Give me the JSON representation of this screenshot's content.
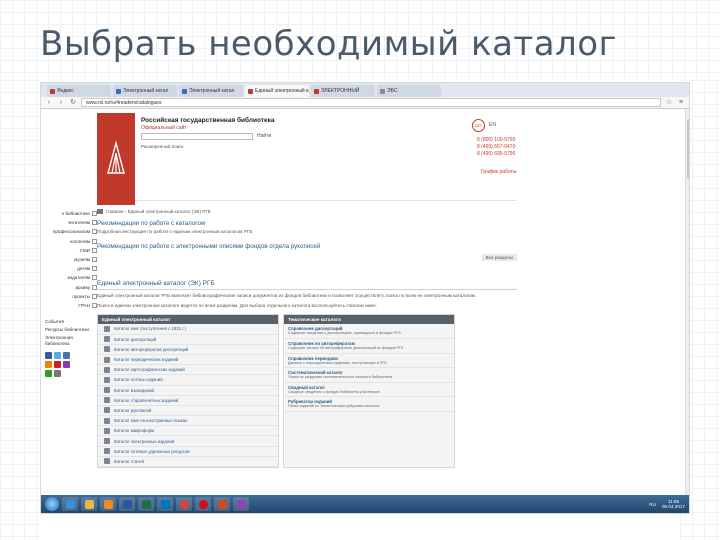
{
  "slide": {
    "title": "Выбрать необходимый каталог"
  },
  "browser": {
    "tabs": [
      {
        "label": "Яндекс",
        "fav": "red"
      },
      {
        "label": "Электронный катал",
        "fav": "blue"
      },
      {
        "label": "Электронный катал",
        "fav": "blue"
      },
      {
        "label": "Единый электронный ка",
        "fav": "red",
        "active": true
      },
      {
        "label": "ЭЛЕКТРОННЫЙ",
        "fav": "red"
      },
      {
        "label": "ЭБС",
        "fav": "gray"
      }
    ],
    "url": "www.rsl.ru/ru/4readers/catalogues"
  },
  "site": {
    "name": "Российская государственная библиотека",
    "subtitle": "Официальный сайт",
    "search_button": "Найти",
    "advanced_search": "Расширенный поиск",
    "age_badge": "12+",
    "lang": "EN",
    "phones": [
      "8 (800) 100-5790",
      "8 (499) 557-0470",
      "8 (495) 695-5790"
    ],
    "schedule_link": "График работы"
  },
  "leftnav": {
    "items": [
      "о библиотеке",
      "читателям",
      "профессионалам",
      "коллегам",
      "СМИ",
      "музеям",
      "детям",
      "издателям",
      "архиву",
      "проекты",
      "ГРАН"
    ],
    "extra": [
      "События",
      "Ресурсы библиотеки",
      "Электронная библиотека"
    ]
  },
  "content": {
    "breadcrumbs": "Главная › Единый электронный каталог (ЭК) РГБ",
    "section1_title": "Рекомендации по работе с каталогом",
    "section1_desc": "Подробная инструкция по работе с единым электронным каталогом РГБ",
    "section2_title": "Рекомендации по работе с электронными описями фондов отдела рукописей",
    "tag_button": "Все разделы",
    "catalog_title": "Единый электронный каталог (ЭК) РГБ",
    "catalog_desc_1": "Единый электронный каталог РГБ включает библиографические записи документов из фондов библиотеки и позволяет осуществлять поиск по всем ее электронным каталогам.",
    "catalog_desc_2": "Поиск в едином электронном каталоге ведется по всем разделам. Для выбора отдельного каталога воспользуйтесь списком ниже."
  },
  "tables": {
    "left_header": "Единый электронный каталог",
    "left_rows": [
      "Каталог книг (поступления с 1831 г.)",
      "Каталог диссертаций",
      "Каталог авторефератов диссертаций",
      "Каталог периодических изданий",
      "Каталог картографических изданий",
      "Каталог нотных изданий",
      "Каталог изоизданий",
      "Каталог старопечатных изданий",
      "Каталог рукописей",
      "Каталог книг на иностранных языках",
      "Каталог микроформ",
      "Каталог электронных изданий",
      "Каталог сетевых удаленных ресурсов",
      "Каталог статей"
    ],
    "right_header": "Тематические каталоги",
    "right_rows": [
      {
        "t": "Справочник диссертаций",
        "d": "Содержит сведения о диссертациях, хранящихся в фондах РГБ"
      },
      {
        "t": "Справочник по авторефератам",
        "d": "Содержит записи об авторефератах диссертаций из фондов РГБ"
      },
      {
        "t": "Справочник периодики",
        "d": "Данные о периодических изданиях, поступающих в РГБ"
      },
      {
        "t": "Систематический каталог",
        "d": "Поиск по разделам систематического каталога библиотеки"
      },
      {
        "t": "Сводный каталог",
        "d": "Сводные сведения о фондах библиотек-участников"
      },
      {
        "t": "Рубрикатор изданий",
        "d": "Поиск изданий по тематическим рубрикам каталога"
      }
    ]
  },
  "taskbar": {
    "time": "11:55",
    "date": "05.04.2017",
    "lang": "RU"
  },
  "colors": {
    "brand_red": "#c0392b",
    "link_blue": "#2b5c8a",
    "table_header": "#58606a"
  }
}
